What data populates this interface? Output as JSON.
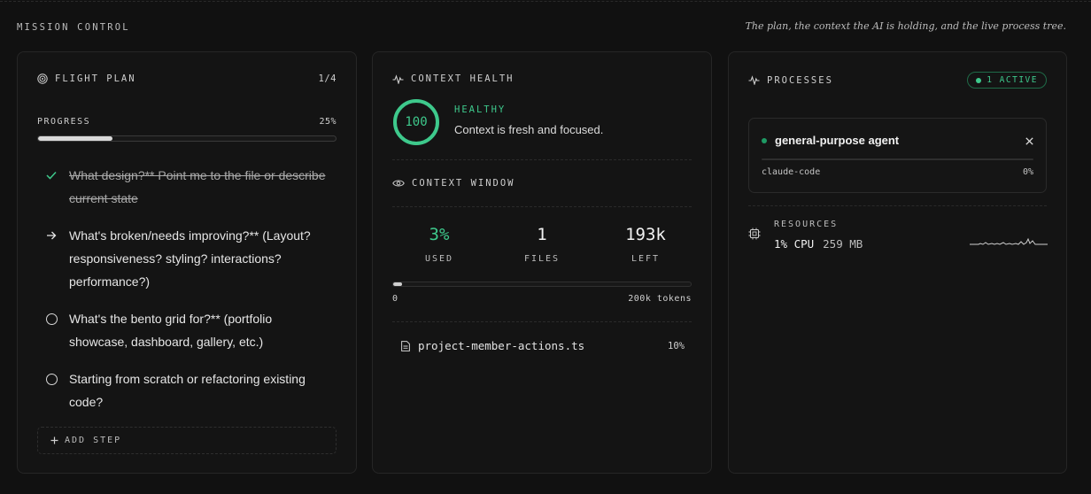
{
  "section": {
    "title": "MISSION CONTROL",
    "subtitle": "The plan, the context the AI is holding, and the live process tree."
  },
  "flight_plan": {
    "title": "FLIGHT PLAN",
    "count": "1/4",
    "progress_label": "PROGRESS",
    "progress_pct": "25%",
    "progress_value": 0.25,
    "steps": [
      {
        "text": "What design?** Point me to the file or describe current state",
        "status": "done"
      },
      {
        "text": "What's broken/needs improving?** (Layout? responsiveness? styling? interactions? performance?)",
        "status": "current"
      },
      {
        "text": "What's the bento grid for?** (portfolio showcase, dashboard, gallery, etc.)",
        "status": "pending"
      },
      {
        "text": "Starting from scratch or refactoring existing code?",
        "status": "pending"
      }
    ],
    "add_step_label": "ADD STEP"
  },
  "context_health": {
    "title": "CONTEXT HEALTH",
    "score": "100",
    "score_value": 100,
    "status": "HEALTHY",
    "description": "Context is fresh and focused."
  },
  "context_window": {
    "title": "CONTEXT WINDOW",
    "stats": [
      {
        "value": "3%",
        "label": "USED"
      },
      {
        "value": "1",
        "label": "FILES"
      },
      {
        "value": "193k",
        "label": "LEFT"
      }
    ],
    "used_fraction": 0.03,
    "scale_min": "0",
    "scale_max": "200k tokens",
    "files": [
      {
        "name": "project-member-actions.ts",
        "pct": "10%"
      }
    ]
  },
  "processes": {
    "title": "PROCESSES",
    "active_badge": "1 ACTIVE",
    "items": [
      {
        "name": "general-purpose agent",
        "source": "claude-code",
        "pct": "0%",
        "progress": 0.0
      }
    ],
    "resources": {
      "label": "RESOURCES",
      "cpu": "1% CPU",
      "memory": "259 MB"
    }
  },
  "colors": {
    "background": "#111111",
    "panel": "#141414",
    "accent_green": "#3ec98c",
    "text": "#e8e8e8"
  }
}
